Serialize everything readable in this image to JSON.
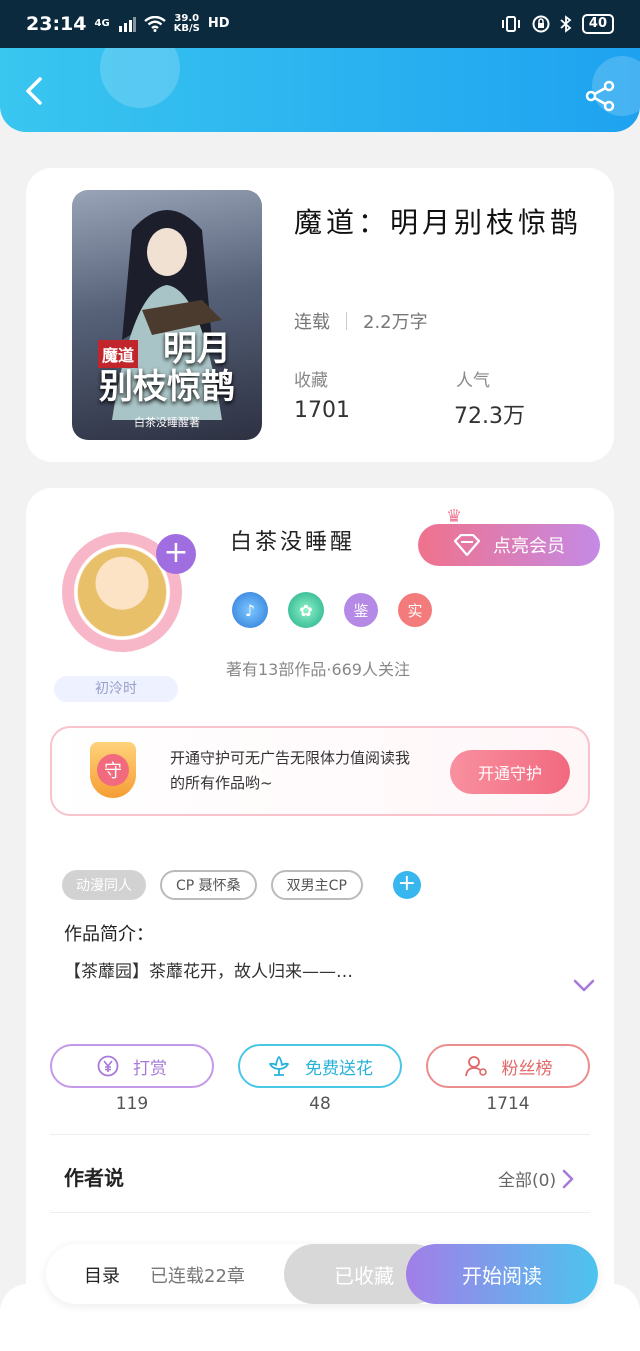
{
  "status_bar": {
    "time": "23:14",
    "network": "4G",
    "speed_value": "39.0",
    "speed_unit": "KB/S",
    "hd": "HD",
    "battery": "40"
  },
  "book": {
    "title": "魔道：明月别枝惊鹊",
    "status": "连载",
    "word_count": "2.2万字",
    "favorites_label": "收藏",
    "favorites_value": "1701",
    "popularity_label": "人气",
    "popularity_value": "72.3万",
    "cover_tag": "魔道",
    "cover_title_line1": "明月",
    "cover_title_line2": "别枝惊鹊",
    "cover_author": "白茶没睡醒著"
  },
  "author": {
    "name": "白茶没睡醒",
    "vip_label": "点亮会员",
    "badge_labels": [
      "鉴",
      "实"
    ],
    "works_info": "著有13部作品·669人关注",
    "avatar_badge": "初泠时"
  },
  "guard": {
    "icon_text": "守",
    "text": "开通守护可无广告无限体力值阅读我的所有作品哟~",
    "button": "开通守护"
  },
  "tags": [
    "动漫同人",
    "CP 聂怀桑",
    "双男主CP"
  ],
  "intro": {
    "label": "作品简介：",
    "text": "【茶蘼园】茶蘼花开，故人归来——…"
  },
  "actions": [
    {
      "label": "打赏",
      "count": "119"
    },
    {
      "label": "免费送花",
      "count": "48"
    },
    {
      "label": "粉丝榜",
      "count": "1714"
    }
  ],
  "author_says": {
    "label": "作者说",
    "all": "全部(0)"
  },
  "bottom_bar": {
    "catalog": "目录",
    "updated": "已连载22章",
    "collected": "已收藏",
    "read": "开始阅读"
  },
  "colors": {
    "header_start": "#39c6ef",
    "header_end": "#1ea2f0",
    "accent_purple": "#a77ad8",
    "accent_blue": "#29b2da",
    "accent_red": "#e26767"
  }
}
